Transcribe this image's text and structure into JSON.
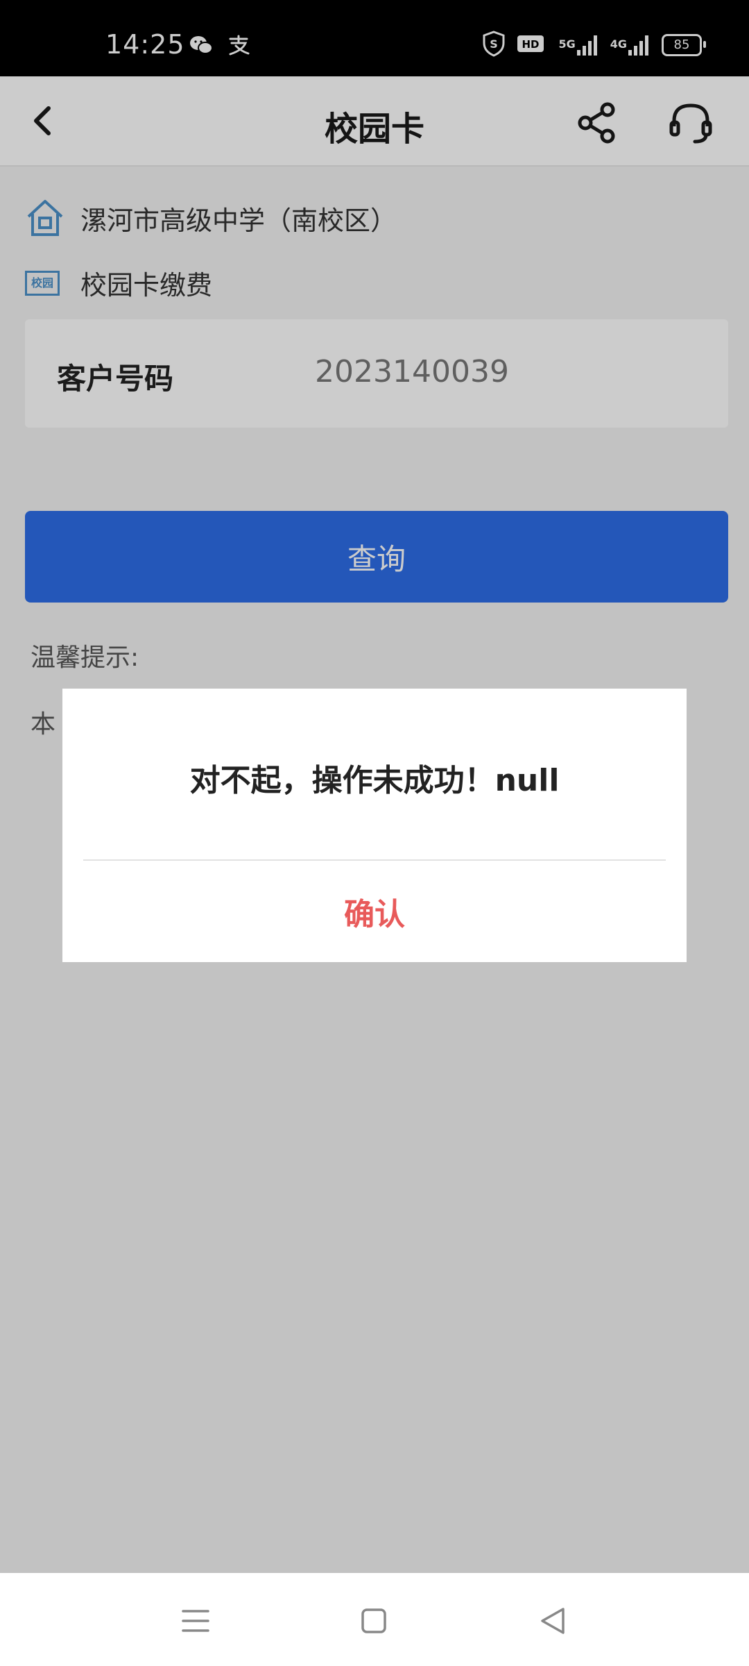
{
  "status_bar": {
    "time": "14:25",
    "icons": [
      "wechat-icon",
      "alipay-icon"
    ],
    "right_icons": [
      "shield-s-icon",
      "hd-icon",
      "5g-signal-icon",
      "4g-signal-icon"
    ],
    "net1": "5G",
    "net2": "4G",
    "battery": "85"
  },
  "header": {
    "title": "校园卡",
    "back_icon": "chevron-left-icon",
    "share_icon": "share-icon",
    "service_icon": "headset-icon"
  },
  "merchant": {
    "school": "漯河市高级中学（南校区）",
    "badge": "校园",
    "service": "校园卡缴费"
  },
  "form": {
    "customer_label": "客户号码",
    "customer_value": "2023140039"
  },
  "actions": {
    "query_label": "查询"
  },
  "tips": {
    "title": "温馨提示:",
    "body_visible": "本"
  },
  "dialog": {
    "message": "对不起，操作未成功！null",
    "confirm_label": "确认"
  },
  "nav_bar": {
    "icons": [
      "menu-icon",
      "home-icon",
      "back-icon"
    ]
  },
  "colors": {
    "primary": "#2e6de8",
    "confirm": "#e85a5a",
    "accent_icon": "#4a90c8"
  }
}
